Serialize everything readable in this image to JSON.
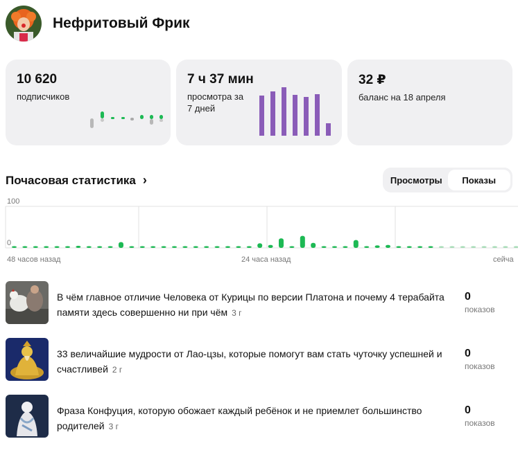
{
  "channel": {
    "name": "Нефритовый Фрик",
    "avatar_icon": "avatar-clown-icon"
  },
  "cards": {
    "subscribers": {
      "value": "10 620",
      "label": "подписчиков"
    },
    "views": {
      "value": "7 ч 37 мин",
      "label": "просмотра за 7 дней",
      "bars_accent": "#8a5cb8"
    },
    "balance": {
      "value": "32 ₽",
      "label": "баланс на 18 апреля"
    }
  },
  "hourly": {
    "title": "Почасовая статистика",
    "tabs": [
      {
        "label": "Просмотры",
        "active": false
      },
      {
        "label": "Показы",
        "active": true
      }
    ]
  },
  "chart_data": {
    "type": "bar",
    "yticks": [
      "100",
      "0"
    ],
    "ylim": [
      0,
      100
    ],
    "xlabels": [
      "48 часов назад",
      "24 часа назад",
      "сейча"
    ],
    "series": [
      {
        "color": "#1db954",
        "values": [
          3,
          3,
          3,
          3,
          3,
          3,
          5,
          3,
          3,
          3,
          14,
          3,
          3,
          3,
          3,
          4,
          3,
          3,
          3,
          3,
          3,
          3,
          3,
          11,
          7,
          23,
          3,
          29,
          12,
          3,
          3,
          3,
          19,
          3,
          6,
          7,
          3,
          3,
          3,
          3
        ]
      },
      {
        "color": "#a6dcb6",
        "values": [
          2,
          2,
          2,
          2,
          2,
          2,
          2,
          2,
          2,
          2,
          2
        ]
      }
    ]
  },
  "videos": [
    {
      "title": "В чём главное отличие Человека от Курицы по версии Платона и почему 4 терабайта памяти здесь совершенно ни при чём",
      "age": "3 г",
      "count": "0",
      "count_label": "показов",
      "thumb_icon": "chicken-thumbnail-icon"
    },
    {
      "title": "33 величайшие мудрости от Лао-цзы, которые помогут вам стать чуточку успешней и счастливей",
      "age": "2 г",
      "count": "0",
      "count_label": "показов",
      "thumb_icon": "laozi-statue-thumbnail-icon"
    },
    {
      "title": "Фраза Конфуция, которую обожает каждый ребёнок и не приемлет большинство родителей",
      "age": "3 г",
      "count": "0",
      "count_label": "показов",
      "thumb_icon": "confucius-statue-thumbnail-icon"
    }
  ]
}
